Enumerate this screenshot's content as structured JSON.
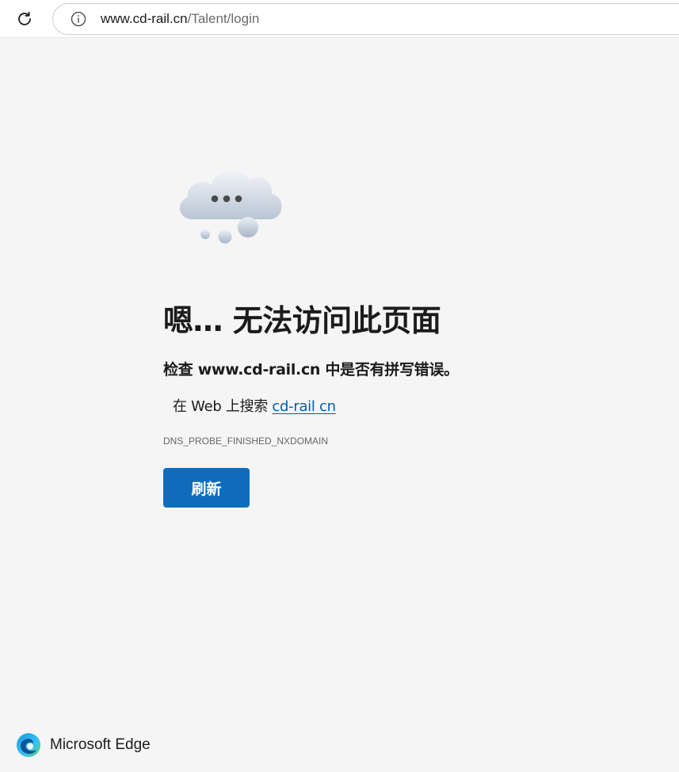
{
  "browser": {
    "address_bar": {
      "host": "www.cd-rail.cn",
      "path": "/Talent/login"
    }
  },
  "error_page": {
    "heading": "嗯… 无法访问此页面",
    "check_text": "检查 www.cd-rail.cn 中是否有拼写错误。",
    "search_prefix": "在 Web 上搜索",
    "search_link": "cd-rail cn",
    "error_code": "DNS_PROBE_FINISHED_NXDOMAIN",
    "refresh_button": "刷新"
  },
  "footer": {
    "brand": "Microsoft Edge"
  },
  "colors": {
    "accent": "#0f6cbd",
    "link": "#0a5aa4",
    "background": "#f5f5f5"
  },
  "icons": [
    "refresh-icon",
    "info-icon",
    "cloud-illustration",
    "edge-logo-icon"
  ]
}
